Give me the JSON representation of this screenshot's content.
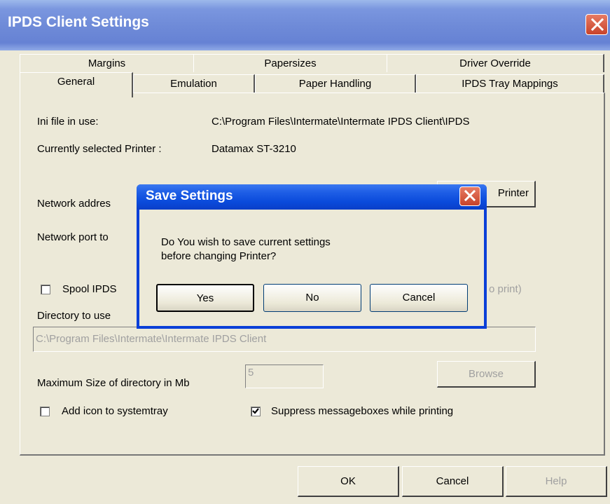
{
  "window": {
    "title": "IPDS Client Settings"
  },
  "tabs": {
    "row1": [
      "Margins",
      "Papersizes",
      "Driver Override"
    ],
    "row2": [
      "General",
      "Emulation",
      "Paper Handling",
      "IPDS Tray Mappings"
    ]
  },
  "general": {
    "ini_label": "Ini file in use:",
    "ini_value": "C:\\Program Files\\Intermate\\Intermate IPDS Client\\IPDS",
    "printer_label": "Currently selected Printer :",
    "printer_value": "Datamax ST-3210",
    "network_address_label": "Network addres",
    "change_printer_label": "Printer",
    "network_port_label": "Network port to",
    "spool_label": "Spool IPDS",
    "spool_suffix": "o print)",
    "spool_checked": false,
    "directory_label": "Directory to use",
    "directory_value": "C:\\Program Files\\Intermate\\Intermate IPDS Client",
    "maxsize_label": "Maximum Size of directory in Mb",
    "maxsize_value": "5",
    "browse_label": "Browse",
    "systray_label": "Add icon to systemtray",
    "systray_checked": false,
    "suppress_label": "Suppress messageboxes while printing",
    "suppress_checked": true
  },
  "footer": {
    "ok": "OK",
    "cancel": "Cancel",
    "help": "Help"
  },
  "dialog": {
    "title": "Save Settings",
    "message_line1": "Do You wish to save current settings",
    "message_line2": "before changing Printer?",
    "yes": "Yes",
    "no": "No",
    "cancel": "Cancel"
  }
}
